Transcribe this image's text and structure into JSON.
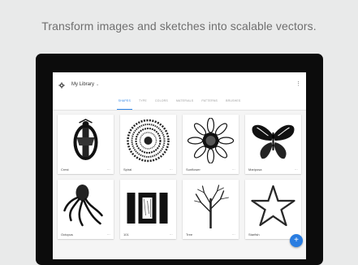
{
  "headline": "Transform images and sketches into scalable vectors.",
  "appbar": {
    "library_title": "My Library",
    "caret": "⌄",
    "kebab": "⋮"
  },
  "tabs": [
    {
      "label": "SHAPES",
      "active": true
    },
    {
      "label": "TYPE",
      "active": false
    },
    {
      "label": "COLORS",
      "active": false
    },
    {
      "label": "MATERIALS",
      "active": false
    },
    {
      "label": "PATTERNS",
      "active": false
    },
    {
      "label": "BRUSHES",
      "active": false
    }
  ],
  "cards": [
    {
      "label": "Crest",
      "more": "⋯"
    },
    {
      "label": "Spiral",
      "more": "⋯"
    },
    {
      "label": "Sunflower",
      "more": "⋯"
    },
    {
      "label": "Mariposa",
      "more": "⋯"
    },
    {
      "label": "Octopus",
      "more": "⋯"
    },
    {
      "label": "101",
      "more": "⋯"
    },
    {
      "label": "Tree",
      "more": "⋯"
    },
    {
      "label": "Starfish",
      "more": "⋯"
    }
  ],
  "fab": {
    "label": "+"
  },
  "colors": {
    "accent": "#2c84e8",
    "fab": "#2a7de1",
    "device": "#0c0c0c",
    "background": "#e9eaea"
  }
}
